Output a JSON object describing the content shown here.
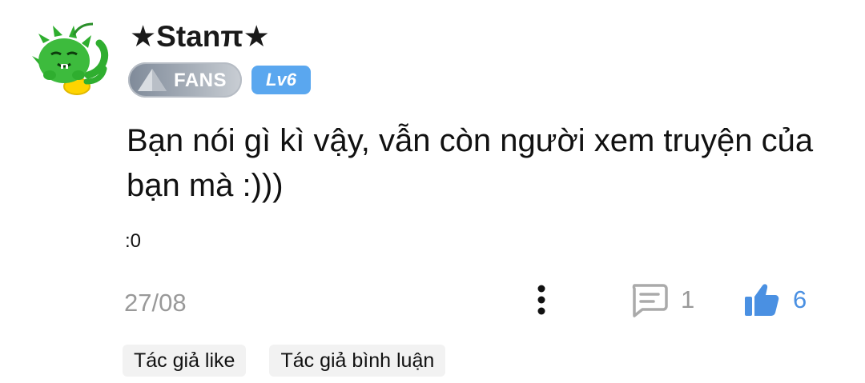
{
  "comment": {
    "username": "★Stanπ★",
    "avatar_icon": "green-dragon-avatar",
    "badges": {
      "fans_label": "FANS",
      "level_label": "Lv6"
    },
    "text": "Bạn nói gì kì vậy, vẫn còn người xem truyện của bạn mà :)))",
    "secondary_text": ":0",
    "date": "27/08",
    "actions": {
      "more_icon": "more-vertical-icon",
      "reply_icon": "comment-bubble-icon",
      "reply_count": "1",
      "like_icon": "thumbs-up-icon",
      "like_count": "6"
    },
    "tags": [
      {
        "label": "Tác giả like"
      },
      {
        "label": "Tác giả bình luận"
      }
    ]
  },
  "colors": {
    "like_accent": "#4a90e2",
    "level_badge": "#5aa7ef",
    "muted_text": "#999999",
    "tag_background": "#f2f2f2",
    "avatar_green": "#3dbb3d"
  }
}
